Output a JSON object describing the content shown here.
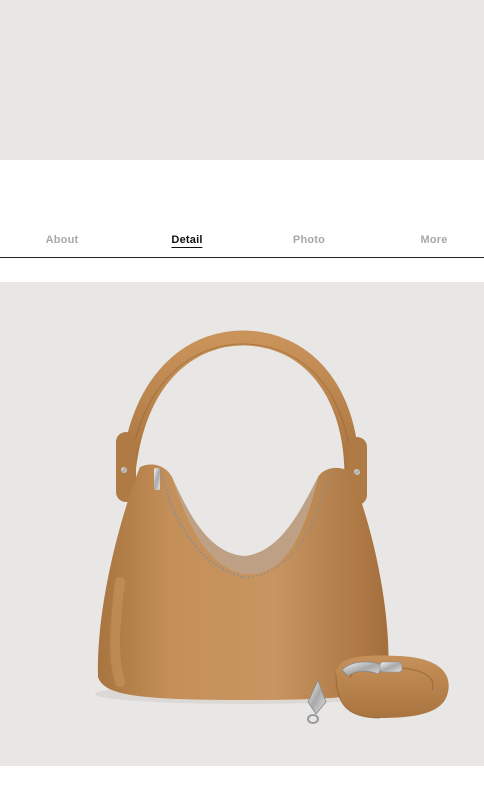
{
  "tabs": [
    {
      "label": "About",
      "active": false
    },
    {
      "label": "Detail",
      "active": true
    },
    {
      "label": "Photo",
      "active": false
    },
    {
      "label": "More",
      "active": false
    }
  ],
  "colors": {
    "photo_background": "#e9e7e5",
    "bag_leather": "#c08a53",
    "active_tab": "#111111",
    "inactive_tab": "#a8a8a8"
  }
}
